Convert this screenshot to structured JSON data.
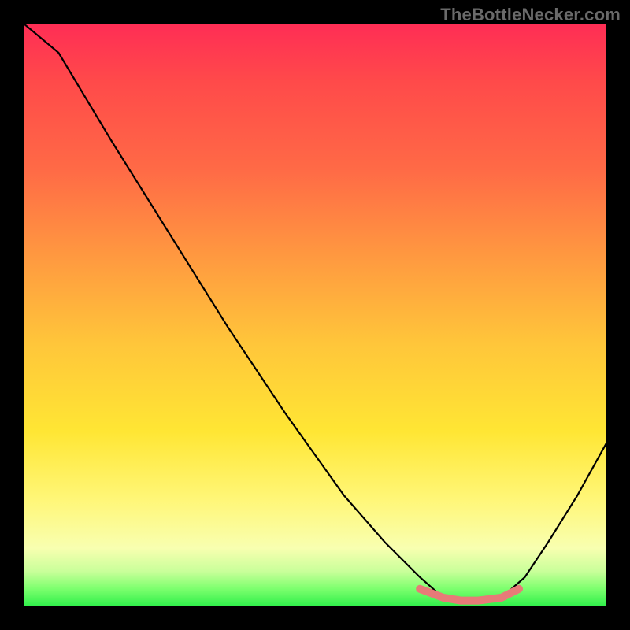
{
  "watermark": "TheBottleNecker.com",
  "chart_data": {
    "type": "line",
    "title": "",
    "xlabel": "",
    "ylabel": "",
    "xlim": [
      0,
      100
    ],
    "ylim": [
      0,
      100
    ],
    "curve": {
      "description": "Bottleneck V-curve: steep drop from top-left to a flat minimum around x≈72–82, then rises toward the right edge.",
      "x": [
        0,
        6,
        15,
        25,
        35,
        45,
        55,
        62,
        68,
        72,
        75,
        78,
        82,
        86,
        90,
        95,
        100
      ],
      "y": [
        100,
        95,
        80,
        64,
        48,
        33,
        19,
        11,
        5,
        1.5,
        1,
        1,
        1.5,
        5,
        11,
        19,
        28
      ]
    },
    "highlight_segment": {
      "description": "Thick salmon segment marking the flat minimum region.",
      "color": "#e77b78",
      "x": [
        68,
        72,
        75,
        78,
        82,
        85
      ],
      "y": [
        3,
        1.5,
        1,
        1,
        1.5,
        3
      ]
    },
    "background_gradient": {
      "stops": [
        {
          "pos": 0,
          "color": "#ff2d55"
        },
        {
          "pos": 25,
          "color": "#ff6a46"
        },
        {
          "pos": 55,
          "color": "#ffc63a"
        },
        {
          "pos": 82,
          "color": "#fff77a"
        },
        {
          "pos": 97,
          "color": "#7cff6e"
        },
        {
          "pos": 100,
          "color": "#2fef4a"
        }
      ]
    }
  }
}
